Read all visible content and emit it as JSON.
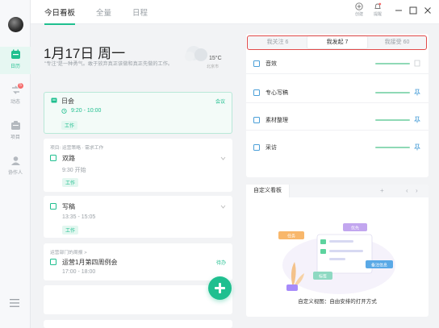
{
  "sidebar": {
    "items": [
      {
        "label": "日历",
        "icon": "calendar-icon",
        "active": true
      },
      {
        "label": "动态",
        "icon": "activity-icon",
        "badge": "5"
      },
      {
        "label": "项目",
        "icon": "project-icon"
      },
      {
        "label": "协作人",
        "icon": "collaborator-icon"
      }
    ],
    "menu_icon": "hamburger-menu-icon"
  },
  "topbar": {
    "tabs": [
      "今日看板",
      "全量",
      "日程"
    ],
    "active_tab": "今日看板",
    "create_label": "创建",
    "remind_label": "提醒"
  },
  "today": {
    "date": "1月17日 周一",
    "subtitle": "\"专注\"是一种勇气。敢于放弃真正该做和真正先做的工作。",
    "temperature": "15°C",
    "city": "北京市"
  },
  "cards": [
    {
      "title": "日会",
      "time": "9:20 - 10:00",
      "tag": "工作",
      "link": "会议"
    },
    {
      "header": "项目: 运营策略 · 需求工作",
      "title": "双路",
      "time": "9:30 开始",
      "tag": "工作"
    },
    {
      "title": "写稿",
      "time": "13:35 - 15:05",
      "tag": "工作"
    },
    {
      "header": "运营部门的周报 >",
      "title": "运营1月第四周例会",
      "time": "17:00 - 18:00",
      "link": "待办"
    }
  ],
  "right_panel": {
    "segments": [
      "我关注 6",
      "我发起 7",
      "我接受 60"
    ],
    "active_segment": "我发起 7",
    "rows": [
      "音效",
      "专心写稿",
      "素材整理",
      "采访"
    ]
  },
  "kanban": {
    "tab": "自定义看板",
    "caption": "自定义视图：自由安排的打开方式",
    "illustration_labels": [
      "任务",
      "优先",
      "标签",
      "备注信息"
    ]
  },
  "colors": {
    "accent": "#1fbf8f",
    "highlight_border": "#e24a4a",
    "badge": "#f56c6c"
  }
}
